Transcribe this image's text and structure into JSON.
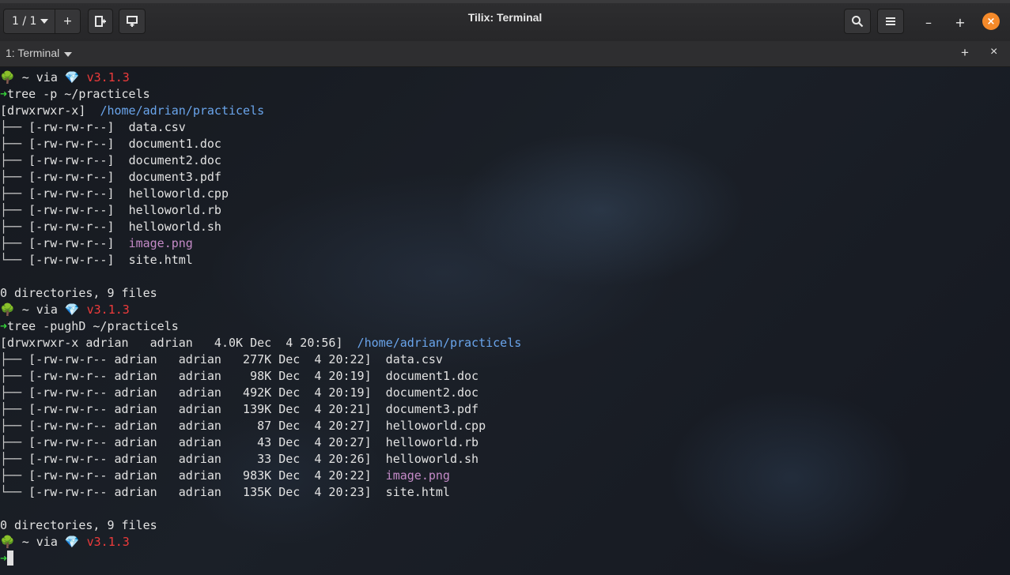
{
  "window": {
    "title": "Tilix: Terminal",
    "session_label": "1 / 1",
    "terminal_tab_title": "1: Terminal"
  },
  "icons": {
    "prompt_tree": "🌳",
    "prompt_gem": "💎",
    "prompt_arrow": "➜",
    "add": "+",
    "minimize": "–",
    "maximize": "+",
    "close": "×"
  },
  "colors": {
    "close_button": "#f58a2a",
    "directory": "#6aa5ec",
    "ruby_version": "#ee3b3b",
    "prompt_arrow": "#36d13a",
    "image_file": "#c48ac7"
  },
  "terminal": {
    "prompt": {
      "path": " ~ via ",
      "version": "v3.1.3"
    },
    "block1": {
      "command": "tree -p ~/practicels",
      "root_meta": "[drwxrwxr-x]  ",
      "root_path": "/home/adrian/practicels",
      "entries": [
        {
          "branch": "├── ",
          "meta": "[-rw-rw-r--]  ",
          "name": "data.csv"
        },
        {
          "branch": "├── ",
          "meta": "[-rw-rw-r--]  ",
          "name": "document1.doc"
        },
        {
          "branch": "├── ",
          "meta": "[-rw-rw-r--]  ",
          "name": "document2.doc"
        },
        {
          "branch": "├── ",
          "meta": "[-rw-rw-r--]  ",
          "name": "document3.pdf"
        },
        {
          "branch": "├── ",
          "meta": "[-rw-rw-r--]  ",
          "name": "helloworld.cpp"
        },
        {
          "branch": "├── ",
          "meta": "[-rw-rw-r--]  ",
          "name": "helloworld.rb"
        },
        {
          "branch": "├── ",
          "meta": "[-rw-rw-r--]  ",
          "name": "helloworld.sh"
        },
        {
          "branch": "├── ",
          "meta": "[-rw-rw-r--]  ",
          "name": "image.png"
        },
        {
          "branch": "└── ",
          "meta": "[-rw-rw-r--]  ",
          "name": "site.html"
        }
      ],
      "summary": "0 directories, 9 files"
    },
    "block2": {
      "command": "tree -pughD ~/practicels",
      "root_meta": "[drwxrwxr-x adrian   adrian   4.0K Dec  4 20:56]  ",
      "root_path": "/home/adrian/practicels",
      "entries": [
        {
          "branch": "├── ",
          "meta": "[-rw-rw-r-- adrian   adrian   277K Dec  4 20:22]  ",
          "name": "data.csv"
        },
        {
          "branch": "├── ",
          "meta": "[-rw-rw-r-- adrian   adrian    98K Dec  4 20:19]  ",
          "name": "document1.doc"
        },
        {
          "branch": "├── ",
          "meta": "[-rw-rw-r-- adrian   adrian   492K Dec  4 20:19]  ",
          "name": "document2.doc"
        },
        {
          "branch": "├── ",
          "meta": "[-rw-rw-r-- adrian   adrian   139K Dec  4 20:21]  ",
          "name": "document3.pdf"
        },
        {
          "branch": "├── ",
          "meta": "[-rw-rw-r-- adrian   adrian     87 Dec  4 20:27]  ",
          "name": "helloworld.cpp"
        },
        {
          "branch": "├── ",
          "meta": "[-rw-rw-r-- adrian   adrian     43 Dec  4 20:27]  ",
          "name": "helloworld.rb"
        },
        {
          "branch": "├── ",
          "meta": "[-rw-rw-r-- adrian   adrian     33 Dec  4 20:26]  ",
          "name": "helloworld.sh"
        },
        {
          "branch": "├── ",
          "meta": "[-rw-rw-r-- adrian   adrian   983K Dec  4 20:22]  ",
          "name": "image.png"
        },
        {
          "branch": "└── ",
          "meta": "[-rw-rw-r-- adrian   adrian   135K Dec  4 20:23]  ",
          "name": "site.html"
        }
      ],
      "summary": "0 directories, 9 files"
    }
  }
}
